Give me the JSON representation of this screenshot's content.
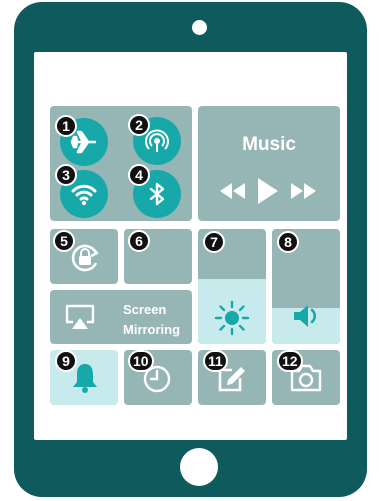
{
  "colors": {
    "frame": "#0f5a5c",
    "tile": "#95b6b5",
    "tile_light": "#c7ebec",
    "accent": "#17a8aa",
    "badge": "#111111",
    "white": "#ffffff"
  },
  "controls": {
    "airplane": {
      "number": "1",
      "icon": "airplane-icon"
    },
    "airdrop": {
      "number": "2",
      "icon": "airdrop-icon"
    },
    "wifi": {
      "number": "3",
      "icon": "wifi-icon"
    },
    "bluetooth": {
      "number": "4",
      "icon": "bluetooth-icon"
    },
    "rotation_lock": {
      "number": "5",
      "icon": "rotation-lock-icon"
    },
    "do_not_disturb": {
      "number": "6",
      "icon": "moon-icon"
    },
    "brightness": {
      "number": "7",
      "icon": "sun-icon"
    },
    "volume": {
      "number": "8",
      "icon": "speaker-icon"
    },
    "silent": {
      "number": "9",
      "icon": "bell-icon"
    },
    "timer": {
      "number": "10",
      "icon": "timer-icon"
    },
    "notes": {
      "number": "11",
      "icon": "pencil-icon"
    },
    "camera": {
      "number": "12",
      "icon": "camera-icon"
    }
  },
  "music": {
    "title": "Music",
    "icons": [
      "rewind-icon",
      "play-icon",
      "fast-forward-icon"
    ]
  },
  "screen_mirroring": {
    "line1": "Screen",
    "line2": "Mirroring",
    "icon": "airplay-icon"
  }
}
